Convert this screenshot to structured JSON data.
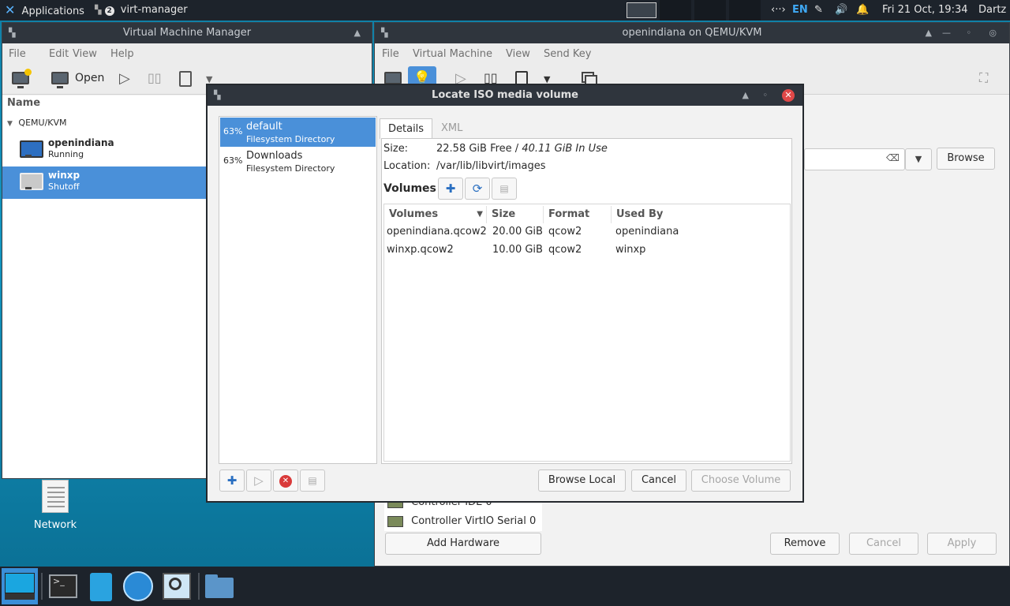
{
  "top_panel": {
    "applications": "Applications",
    "window_badge": "2",
    "active_app": "virt-manager",
    "keyboard_layout": "EN",
    "clock": "Fri 21 Oct, 19:34",
    "user": "Dartz"
  },
  "desktop": {
    "network_label": "Network"
  },
  "vmm": {
    "title": "Virtual Machine Manager",
    "menu": [
      "File",
      "Edit",
      "View",
      "Help"
    ],
    "open_label": "Open",
    "list_header": "Name",
    "group": "QEMU/KVM",
    "vms": [
      {
        "name": "openindiana",
        "state": "Running"
      },
      {
        "name": "winxp",
        "state": "Shutoff"
      }
    ]
  },
  "vm_window": {
    "title": "openindiana on QEMU/KVM",
    "menu": [
      "File",
      "Virtual Machine",
      "View",
      "Send Key"
    ],
    "browse_label": "Browse",
    "hw_items": [
      "Controller IDE 0",
      "Controller VirtIO Serial 0"
    ],
    "add_hardware": "Add Hardware",
    "remove": "Remove",
    "cancel": "Cancel",
    "apply": "Apply"
  },
  "dialog": {
    "title": "Locate ISO media volume",
    "pools": [
      {
        "percent": "63%",
        "name": "default",
        "type": "Filesystem Directory",
        "selected": true
      },
      {
        "percent": "63%",
        "name": "Downloads",
        "type": "Filesystem Directory",
        "selected": false
      }
    ],
    "tabs": [
      "Details",
      "XML"
    ],
    "size_label": "Size:",
    "size_free": "22.58 GiB Free / ",
    "size_used": "40.11 GiB In Use",
    "location_label": "Location:",
    "location_value": "/var/lib/libvirt/images",
    "volumes_label": "Volumes",
    "columns": [
      "Volumes",
      "Size",
      "Format",
      "Used By"
    ],
    "volumes": [
      {
        "name": "openindiana.qcow2",
        "size": "20.00 GiB",
        "format": "qcow2",
        "used_by": "openindiana"
      },
      {
        "name": "winxp.qcow2",
        "size": "10.00 GiB",
        "format": "qcow2",
        "used_by": "winxp"
      }
    ],
    "browse_local": "Browse Local",
    "cancel": "Cancel",
    "choose_volume": "Choose Volume"
  },
  "colors": {
    "selection": "#4a90d9",
    "panel_dark": "#1d232b",
    "desktop": "#1396c1"
  }
}
